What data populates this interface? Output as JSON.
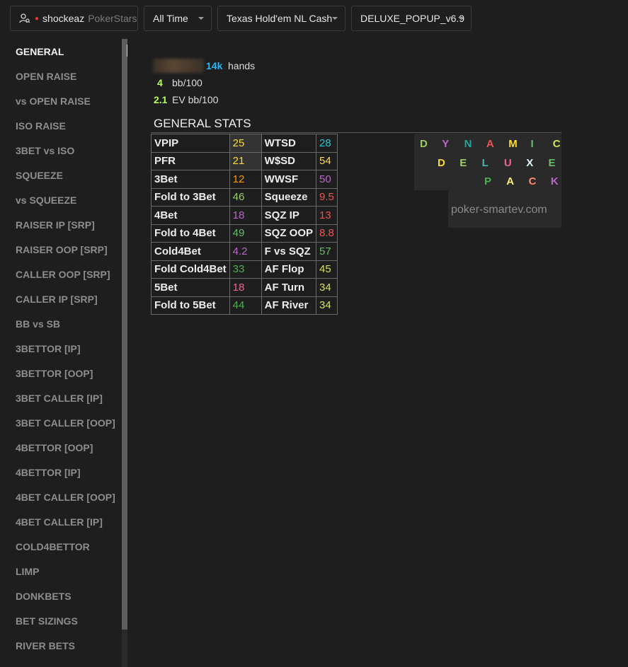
{
  "topbar": {
    "username": "shockeaz",
    "site": "PokerStars",
    "time_filter": "All Time",
    "game_filter": "Texas Hold'em NL Cash",
    "popup": "DELUXE_POPUP_v6.9"
  },
  "sidebar": {
    "items": [
      "GENERAL",
      "OPEN RAISE",
      "vs OPEN RAISE",
      "ISO RAISE",
      "3BET vs ISO",
      "SQUEEZE",
      "vs SQUEEZE",
      "RAISER IP [SRP]",
      "RAISER OOP [SRP]",
      "CALLER OOP [SRP]",
      "CALLER IP [SRP]",
      "BB vs SB",
      "3BETTOR [IP]",
      "3BETTOR [OOP]",
      "3BET CALLER [IP]",
      "3BET CALLER [OOP]",
      "4BETTOR [OOP]",
      "4BETTOR [IP]",
      "4BET CALLER [OOP]",
      "4BET CALLER [IP]",
      "COLD4BETTOR",
      "LIMP",
      "DONKBETS",
      "BET SIZINGS",
      "RIVER BETS"
    ],
    "active_index": 0
  },
  "summary": {
    "hands_count": "14k",
    "hands_label": "hands",
    "winrate": "4",
    "winrate_label": "bb/100",
    "ev_winrate": "2.1",
    "ev_label": "EV bb/100"
  },
  "general_stats": {
    "title": "GENERAL STATS",
    "rows": [
      {
        "l1": "VPIP",
        "v1": "25",
        "c1": "#fdd835",
        "l2": "WTSD",
        "v2": "28",
        "c2": "#26c6da"
      },
      {
        "l1": "PFR",
        "v1": "21",
        "c1": "#fdd835",
        "l2": "W$SD",
        "v2": "54",
        "c2": "#ffd54f"
      },
      {
        "l1": "3Bet",
        "v1": "12",
        "c1": "#ff9800",
        "l2": "WWSF",
        "v2": "50",
        "c2": "#ba68c8"
      },
      {
        "l1": "Fold to 3Bet",
        "v1": "46",
        "c1": "#9ccc65",
        "l2": "Squeeze",
        "v2": "9.5",
        "c2": "#ef5350"
      },
      {
        "l1": "4Bet",
        "v1": "18",
        "c1": "#ba68c8",
        "l2": "SQZ IP",
        "v2": "13",
        "c2": "#ef5350"
      },
      {
        "l1": "Fold to 4Bet",
        "v1": "49",
        "c1": "#66bb6a",
        "l2": "SQZ OOP",
        "v2": "8.8",
        "c2": "#ef5350"
      },
      {
        "l1": "Cold4Bet",
        "v1": "4.2",
        "c1": "#ba68c8",
        "l2": "F vs SQZ",
        "v2": "57",
        "c2": "#66bb6a"
      },
      {
        "l1": "Fold Cold4Bet",
        "v1": "33",
        "c1": "#4caf50",
        "l2": "AF Flop",
        "v2": "45",
        "c2": "#d4e157"
      },
      {
        "l1": "5Bet",
        "v1": "18",
        "c1": "#f06292",
        "l2": "AF Turn",
        "v2": "34",
        "c2": "#d4e157"
      },
      {
        "l1": "Fold to 5Bet",
        "v1": "44",
        "c1": "#4caf50",
        "l2": "AF River",
        "v2": "34",
        "c2": "#d4e157"
      }
    ]
  },
  "promo": {
    "word1": [
      {
        "ch": "D",
        "color": "#9ccc65"
      },
      {
        "ch": "Y",
        "color": "#ba68c8"
      },
      {
        "ch": "N",
        "color": "#26a69a"
      },
      {
        "ch": "A",
        "color": "#ef5350"
      },
      {
        "ch": "M",
        "color": "#fdd835"
      },
      {
        "ch": "I",
        "color": "#66bb6a"
      },
      {
        "ch": "C",
        "color": "#d4e157"
      }
    ],
    "word2": [
      {
        "ch": "D",
        "color": "#fdd835"
      },
      {
        "ch": "E",
        "color": "#9ccc65"
      },
      {
        "ch": "L",
        "color": "#4db6ac"
      },
      {
        "ch": "U",
        "color": "#f06292"
      },
      {
        "ch": "X",
        "color": "#e0f7fa"
      },
      {
        "ch": "E",
        "color": "#66bb6a"
      }
    ],
    "word3": [
      {
        "ch": "P",
        "color": "#4caf50"
      },
      {
        "ch": "A",
        "color": "#fff176"
      },
      {
        "ch": "C",
        "color": "#ff8a65"
      },
      {
        "ch": "K",
        "color": "#ba68c8"
      }
    ],
    "site": "poker-smartev.com"
  }
}
